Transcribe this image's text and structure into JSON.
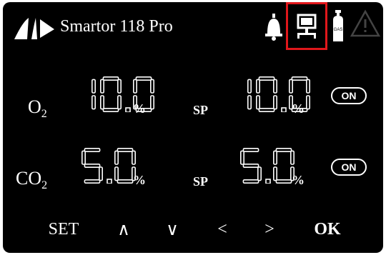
{
  "header": {
    "title": "Smartor 118 Pro",
    "icons": [
      "logo-icon",
      "bell-icon",
      "network-icon",
      "gas-cylinder-icon",
      "warning-icon"
    ],
    "gas_icon_text": "GAS",
    "highlight_color": "#e0171b"
  },
  "o2": {
    "label": "O",
    "label_sub": "2",
    "value": "10.0",
    "unit": "%",
    "sp_label": "SP",
    "setpoint": "10.0",
    "sp_unit": "%",
    "toggle": "ON"
  },
  "co2": {
    "label": "CO",
    "label_sub": "2",
    "value": "5.0",
    "unit": "%",
    "sp_label": "SP",
    "setpoint": "5.0",
    "sp_unit": "%",
    "toggle": "ON"
  },
  "nav": {
    "set": "SET",
    "up": "∧",
    "down": "∨",
    "left": "<",
    "right": ">",
    "ok": "OK"
  }
}
